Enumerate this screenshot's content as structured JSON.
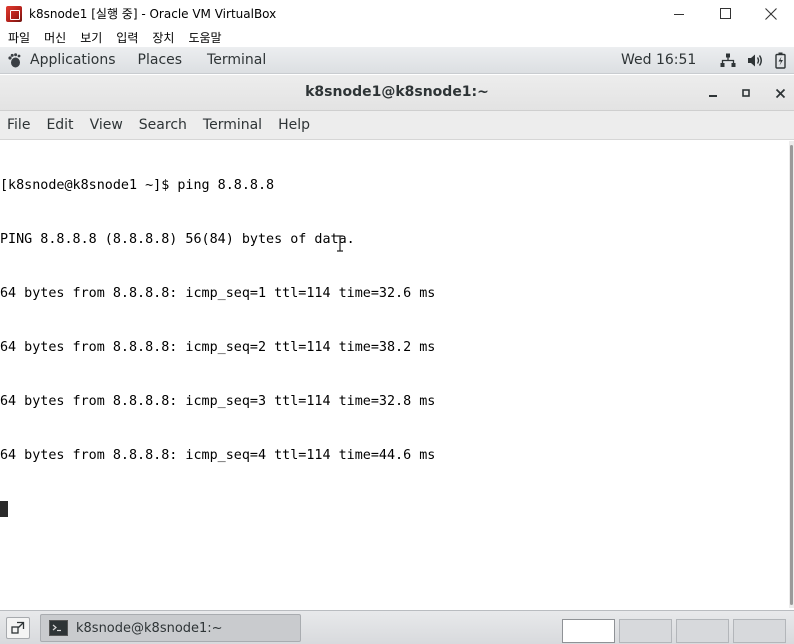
{
  "host_window": {
    "title": "k8snode1 [실행 중] - Oracle VM VirtualBox",
    "menu": [
      "파일",
      "머신",
      "보기",
      "입력",
      "장치",
      "도움말"
    ]
  },
  "top_panel": {
    "applications": "Applications",
    "places": "Places",
    "terminal": "Terminal",
    "clock": "Wed 16:51"
  },
  "terminal_window": {
    "title": "k8snode1@k8snode1:~",
    "menu": [
      "File",
      "Edit",
      "View",
      "Search",
      "Terminal",
      "Help"
    ],
    "lines": [
      "[k8snode@k8snode1 ~]$ ping 8.8.8.8",
      "PING 8.8.8.8 (8.8.8.8) 56(84) bytes of data.",
      "64 bytes from 8.8.8.8: icmp_seq=1 ttl=114 time=32.6 ms",
      "64 bytes from 8.8.8.8: icmp_seq=2 ttl=114 time=38.2 ms",
      "64 bytes from 8.8.8.8: icmp_seq=3 ttl=114 time=32.8 ms",
      "64 bytes from 8.8.8.8: icmp_seq=4 ttl=114 time=44.6 ms"
    ]
  },
  "taskbar": {
    "task_label": "k8snode@k8snode1:~",
    "workspaces": [
      {
        "active": true
      },
      {
        "active": false
      },
      {
        "active": false
      },
      {
        "active": false
      }
    ]
  },
  "icons": {
    "vbox_logo": "virtualbox-logo-icon",
    "minimize": "minimize-icon",
    "maximize": "maximize-icon",
    "close": "close-icon",
    "applications": "gnome-foot-icon",
    "network": "network-icon",
    "volume": "volume-icon",
    "battery": "battery-icon",
    "show_desktop": "show-desktop-icon",
    "terminal": "terminal-icon"
  }
}
